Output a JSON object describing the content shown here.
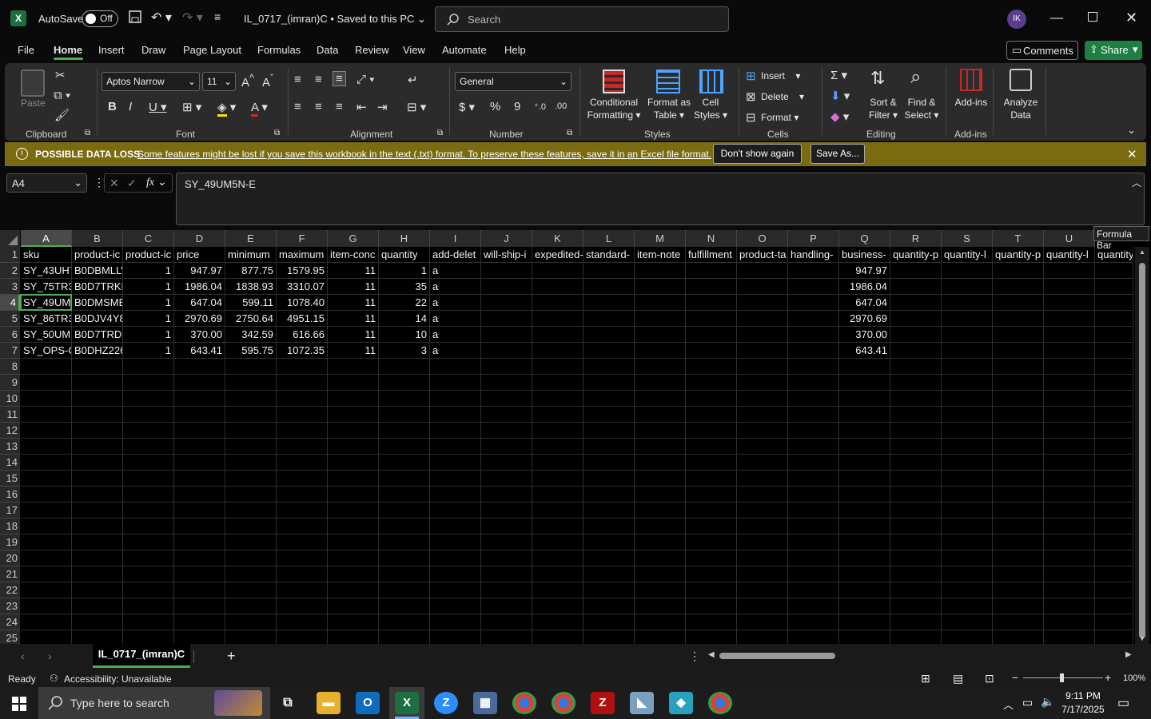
{
  "titlebar": {
    "autosave_label": "AutoSave",
    "autosave_state": "Off",
    "doc_title": "IL_0717_(imran)C • Saved to this PC",
    "search_placeholder": "Search",
    "avatar_initials": "IK"
  },
  "menu": {
    "items": [
      "File",
      "Home",
      "Insert",
      "Draw",
      "Page Layout",
      "Formulas",
      "Data",
      "Review",
      "View",
      "Automate",
      "Help"
    ],
    "active": "Home",
    "comments_label": "Comments",
    "share_label": "Share"
  },
  "ribbon": {
    "clipboard": {
      "label": "Clipboard",
      "paste": "Paste"
    },
    "font": {
      "label": "Font",
      "family": "Aptos Narrow",
      "size": "11"
    },
    "alignment": {
      "label": "Alignment"
    },
    "number": {
      "label": "Number",
      "format": "General"
    },
    "styles": {
      "label": "Styles",
      "conditional": [
        "Conditional",
        "Formatting"
      ],
      "format_table": [
        "Format as",
        "Table"
      ],
      "cell_styles": [
        "Cell",
        "Styles"
      ]
    },
    "cells": {
      "label": "Cells",
      "insert": "Insert",
      "delete": "Delete",
      "format": "Format"
    },
    "editing": {
      "label": "Editing",
      "sort": [
        "Sort &",
        "Filter"
      ],
      "find": [
        "Find &",
        "Select"
      ]
    },
    "addins": {
      "label": "Add-ins",
      "addins": "Add-ins",
      "analyze": [
        "Analyze",
        "Data"
      ]
    }
  },
  "warning": {
    "label": "POSSIBLE DATA LOSS",
    "message": "Some features might be lost if you save this workbook in the text (.txt) format. To preserve these features, save it in an Excel file format.",
    "dont_show": "Don't show again",
    "save_as": "Save As..."
  },
  "formula_bar": {
    "name_box": "A4",
    "formula": "SY_49UM5N-E",
    "tooltip": "Formula Bar"
  },
  "sheet": {
    "columns": [
      "A",
      "B",
      "C",
      "D",
      "E",
      "F",
      "G",
      "H",
      "I",
      "J",
      "K",
      "L",
      "M",
      "N",
      "O",
      "P",
      "Q",
      "R",
      "S",
      "T",
      "U"
    ],
    "rows": [
      "1",
      "2",
      "3",
      "4",
      "5",
      "6",
      "7",
      "8",
      "9",
      "10",
      "11",
      "12",
      "13",
      "14",
      "15",
      "16",
      "17",
      "18",
      "19",
      "20",
      "21",
      "22",
      "23",
      "24",
      "25"
    ],
    "headers": [
      "sku",
      "product-ic",
      "product-ic",
      "price",
      "minimum",
      "maximum",
      "item-conc",
      "quantity",
      "add-delet",
      "will-ship-i",
      "expedited-",
      "standard-",
      "item-note",
      "fulfillment",
      "product-ta",
      "handling-",
      "business-",
      "quantity-p",
      "quantity-l",
      "quantity-p",
      "quantity-l",
      "quantity"
    ],
    "data": [
      [
        "SY_43UH7l",
        "B0DBMLLV",
        "1",
        "947.97",
        "877.75",
        "1579.95",
        "11",
        "1",
        "a",
        "947.97"
      ],
      [
        "SY_75TR3l",
        "B0D7TRKP",
        "1",
        "1986.04",
        "1838.93",
        "3310.07",
        "11",
        "35",
        "a",
        "1986.04"
      ],
      [
        "SY_49UM5",
        "B0DMSMB",
        "1",
        "647.04",
        "599.11",
        "1078.40",
        "11",
        "22",
        "a",
        "647.04"
      ],
      [
        "SY_86TR3l",
        "B0DJV4Y8",
        "1",
        "2970.69",
        "2750.64",
        "4951.15",
        "11",
        "14",
        "a",
        "2970.69"
      ],
      [
        "SY_50UM3",
        "B0D7TRD3",
        "1",
        "370.00",
        "342.59",
        "616.66",
        "11",
        "10",
        "a",
        "370.00"
      ],
      [
        "SY_OPS-C",
        "B0DHZ226",
        "1",
        "643.41",
        "595.75",
        "1072.35",
        "11",
        "3",
        "a",
        "643.41"
      ]
    ],
    "tab_name": "IL_0717_(imran)C"
  },
  "status": {
    "ready": "Ready",
    "accessibility": "Accessibility: Unavailable",
    "zoom": "100%"
  },
  "taskbar": {
    "search_placeholder": "Type here to search",
    "time": "9:11 PM",
    "date": "7/17/2025"
  }
}
